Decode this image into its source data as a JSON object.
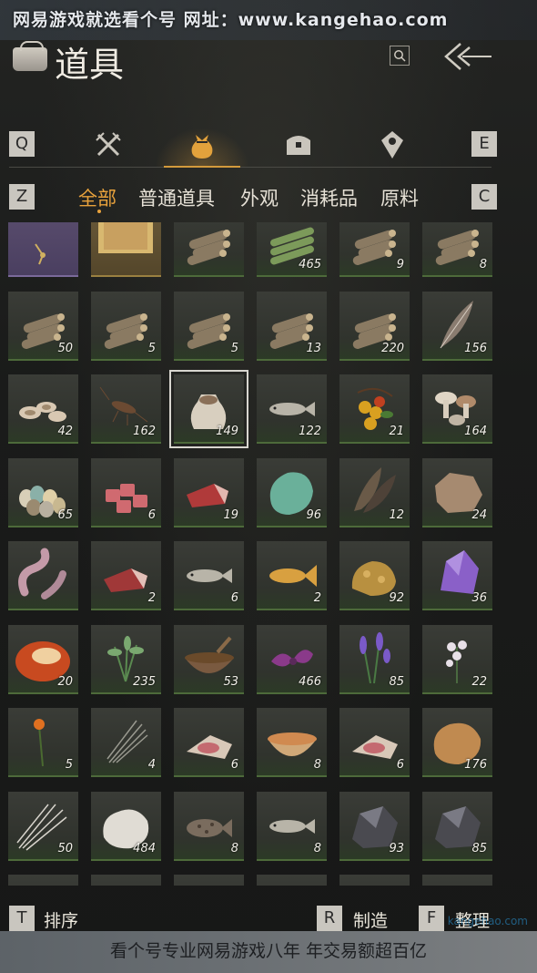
{
  "watermark_top": "网易游戏就选看个号  网址：www.kangehao.com",
  "header": {
    "title": "道具"
  },
  "category_tabs": {
    "left_key": "Q",
    "right_key": "E",
    "tabs": [
      {
        "icon": "crossed-swords-icon",
        "active": false
      },
      {
        "icon": "pouch-icon",
        "active": true
      },
      {
        "icon": "chest-icon",
        "active": false
      },
      {
        "icon": "map-pin-icon",
        "active": false
      }
    ]
  },
  "subtabs": {
    "left_key": "Z",
    "right_key": "C",
    "items": [
      "全部",
      "普通道具",
      "外观",
      "消耗品",
      "原料"
    ],
    "active_index": 0
  },
  "inventory": {
    "selected_index": 14,
    "rows": [
      [
        {
          "icon": "ornament-icon",
          "qty": ""
        },
        {
          "icon": "scroll-painting-icon",
          "qty": ""
        },
        {
          "icon": "log-pile-icon",
          "qty": ""
        },
        {
          "icon": "bamboo-bundle-icon",
          "qty": "465"
        },
        {
          "icon": "log-pile-icon",
          "qty": "9"
        },
        {
          "icon": "log-pile-icon",
          "qty": "8"
        }
      ],
      [
        {
          "icon": "log-pile-icon",
          "qty": "50"
        },
        {
          "icon": "log-pile-icon",
          "qty": "5"
        },
        {
          "icon": "log-pile-icon",
          "qty": "5"
        },
        {
          "icon": "log-pile-icon",
          "qty": "13"
        },
        {
          "icon": "log-pile-icon",
          "qty": "220"
        },
        {
          "icon": "feather-icon",
          "qty": "156"
        }
      ],
      [
        {
          "icon": "mushroom-slices-icon",
          "qty": "42"
        },
        {
          "icon": "cricket-icon",
          "qty": "162"
        },
        {
          "icon": "grain-sack-icon",
          "qty": "149"
        },
        {
          "icon": "fish-icon",
          "qty": "122"
        },
        {
          "icon": "berries-icon",
          "qty": "21"
        },
        {
          "icon": "mushrooms-icon",
          "qty": "164"
        }
      ],
      [
        {
          "icon": "eggs-icon",
          "qty": "65"
        },
        {
          "icon": "meat-cubes-icon",
          "qty": "6"
        },
        {
          "icon": "meat-steak-icon",
          "qty": "19"
        },
        {
          "icon": "jade-stone-icon",
          "qty": "96"
        },
        {
          "icon": "feathers-icon",
          "qty": "12"
        },
        {
          "icon": "hide-icon",
          "qty": "24"
        }
      ],
      [
        {
          "icon": "entrails-icon",
          "qty": ""
        },
        {
          "icon": "meat-slab-icon",
          "qty": "2"
        },
        {
          "icon": "fish-icon",
          "qty": "6"
        },
        {
          "icon": "carp-icon",
          "qty": "2"
        },
        {
          "icon": "ore-icon",
          "qty": "92"
        },
        {
          "icon": "amethyst-icon",
          "qty": "36"
        }
      ],
      [
        {
          "icon": "amber-stone-icon",
          "qty": "20"
        },
        {
          "icon": "herb-icon",
          "qty": "235"
        },
        {
          "icon": "spice-bowl-icon",
          "qty": "53"
        },
        {
          "icon": "purple-flower-icon",
          "qty": "466"
        },
        {
          "icon": "lavender-icon",
          "qty": "85"
        },
        {
          "icon": "white-flower-icon",
          "qty": "22"
        }
      ],
      [
        {
          "icon": "orange-flower-icon",
          "qty": "5"
        },
        {
          "icon": "grass-icon",
          "qty": "4"
        },
        {
          "icon": "raw-meat-icon",
          "qty": "6"
        },
        {
          "icon": "soup-bowl-icon",
          "qty": "8"
        },
        {
          "icon": "raw-meat-icon",
          "qty": "6"
        },
        {
          "icon": "fur-icon",
          "qty": "176"
        }
      ],
      [
        {
          "icon": "quills-icon",
          "qty": "50"
        },
        {
          "icon": "wool-icon",
          "qty": "484"
        },
        {
          "icon": "spotted-fish-icon",
          "qty": "8"
        },
        {
          "icon": "fish-icon",
          "qty": "8"
        },
        {
          "icon": "coal-icon",
          "qty": "93"
        },
        {
          "icon": "coal-icon",
          "qty": "85"
        }
      ],
      [
        {
          "icon": "blue-ore-icon",
          "qty": ""
        },
        {
          "icon": "log-pile-icon",
          "qty": ""
        },
        {
          "icon": "melon-icon",
          "qty": ""
        },
        {
          "icon": "orange-fruit-icon",
          "qty": ""
        },
        {
          "icon": "red-berry-icon",
          "qty": ""
        },
        {
          "icon": "white-flower-icon",
          "qty": ""
        }
      ]
    ]
  },
  "footer": {
    "sort": {
      "key": "T",
      "label": "排序"
    },
    "craft": {
      "key": "R",
      "label": "制造"
    },
    "organize": {
      "key": "F",
      "label": "整理"
    }
  },
  "watermark_bottom": "看个号专业网易游戏八年 年交易额超百亿",
  "watermark_corner": "kangehao.com",
  "colors": {
    "accent": "#e8a23c",
    "cell_green": "#4d6a3a",
    "background": "#1b1c1b"
  }
}
